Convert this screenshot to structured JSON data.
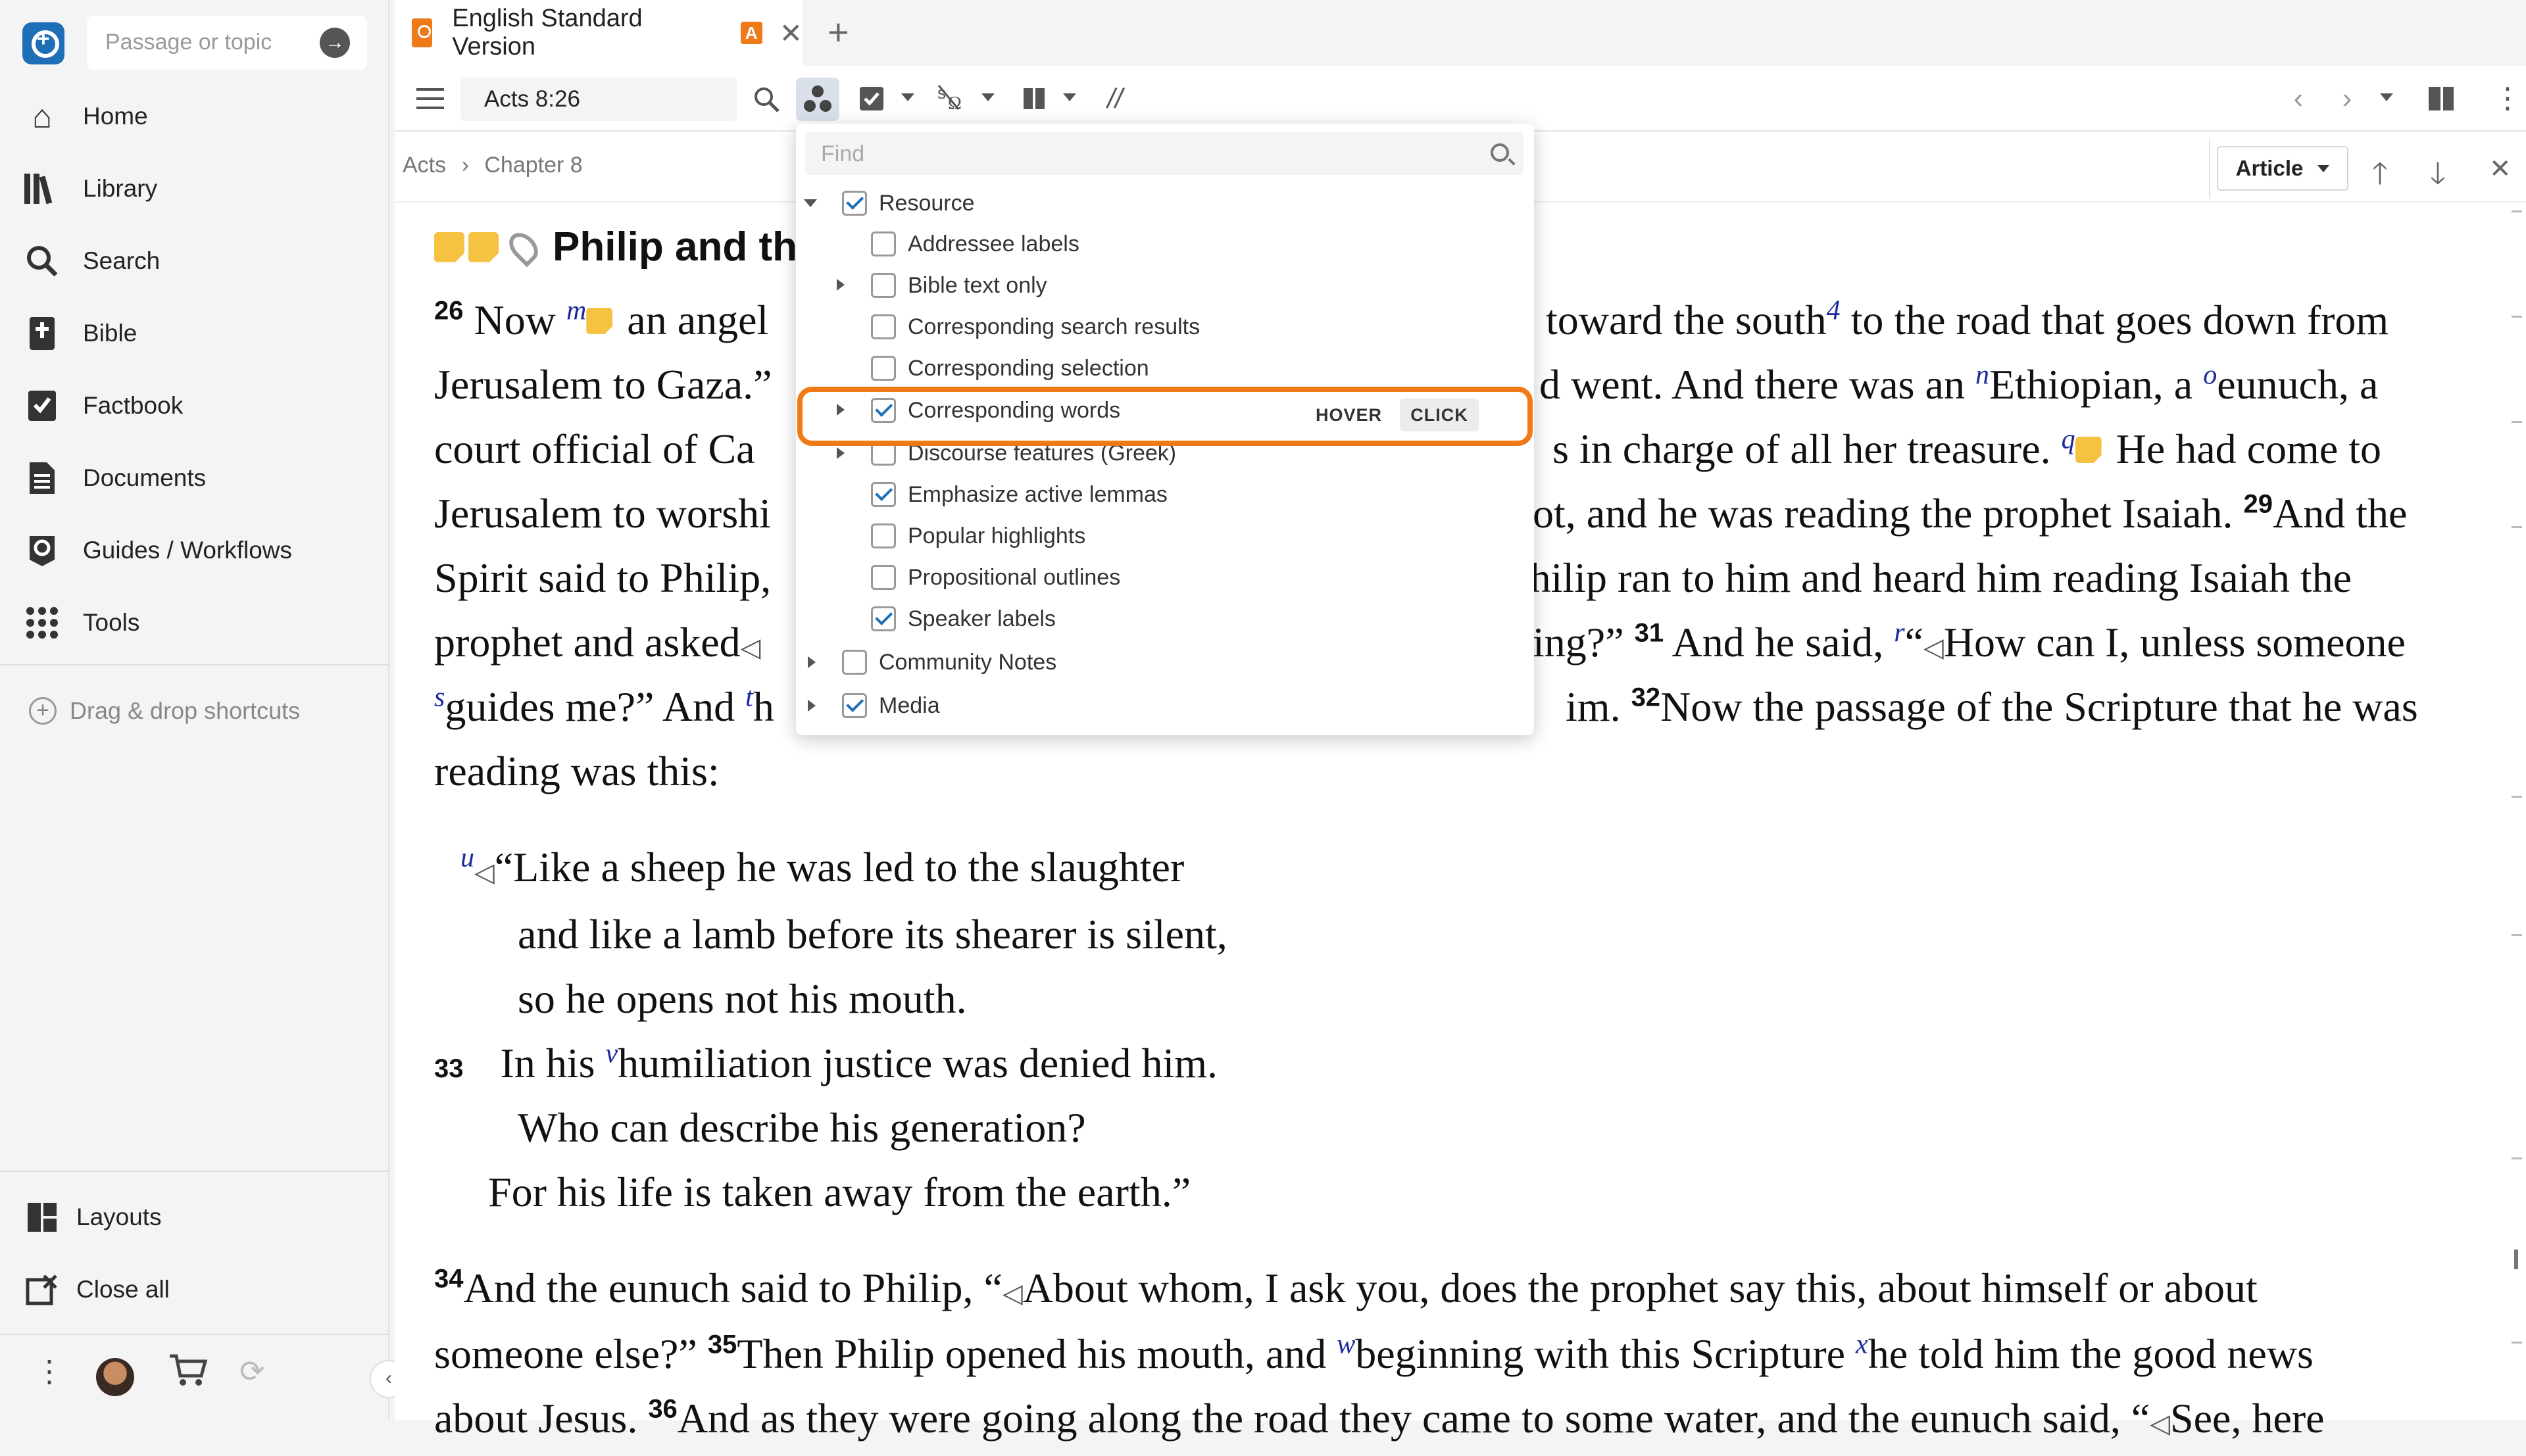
{
  "sidebar": {
    "passage_placeholder": "Passage or topic",
    "items": [
      {
        "label": "Home"
      },
      {
        "label": "Library"
      },
      {
        "label": "Search"
      },
      {
        "label": "Bible"
      },
      {
        "label": "Factbook"
      },
      {
        "label": "Documents"
      },
      {
        "label": "Guides / Workflows"
      },
      {
        "label": "Tools"
      }
    ],
    "drag_drop": "Drag & drop shortcuts",
    "layouts": "Layouts",
    "close_all": "Close all"
  },
  "tab": {
    "title": "English Standard Version",
    "badge": "A"
  },
  "toolbar": {
    "reference": "Acts 8:26",
    "parallel_marker": "//"
  },
  "breadcrumb": {
    "book": "Acts",
    "chapter": "Chapter 8"
  },
  "article_button": "Article",
  "passage": {
    "heading": "Philip and th",
    "v26_num": "26",
    "p1_line1": "Now",
    "p1_line1b": "an angel",
    "p1_line1c": "toward the south",
    "p1_line1d": "to the road that goes down from",
    "p1_line2a": "Jerusalem to Gaza.”",
    "p1_line2b": "d went. And there was an",
    "p1_line2c": "Ethiopian, a",
    "p1_line2d": "eunuch, a",
    "p1_line3a": "court official of Ca",
    "p1_line3b": "s in charge of all her treasure.",
    "p1_line3c": "He had come to",
    "p1_line4a": "Jerusalem to worshi",
    "p1_line4b": "ot, and he was reading the prophet Isaiah.",
    "v29_num": "29",
    "p1_line4c": "And the",
    "p1_line5a": "Spirit said to Philip,",
    "p1_line5b": "Philip ran to him and heard him reading Isaiah the",
    "p1_line6a": "prophet and asked",
    "p1_line6b": "ing?”",
    "v31_num": "31",
    "p1_line6c": "And he said,",
    "p1_line6d": "“",
    "p1_line6e": "How can I, unless someone",
    "p1_line7a": "guides me?” And",
    "p1_line7b": "h",
    "p1_line7c": "im.",
    "v32_num": "32",
    "p1_line7d": "Now the passage of the Scripture that he was",
    "p1_line8": "reading was this:",
    "fn_m": "m",
    "fn_4": "4",
    "fn_n": "n",
    "fn_o": "o",
    "fn_q": "q",
    "fn_r": "r",
    "fn_s": "s",
    "fn_t": "t",
    "poem": {
      "fn_u": "u",
      "l1": "“Like a sheep he was led to the slaughter",
      "l2": "and like a lamb before its shearer is silent,",
      "l3": "so he opens not his mouth.",
      "v33": "33",
      "l4a": "In his",
      "fn_v": "v",
      "l4b": "humiliation justice was denied him.",
      "l5": "Who can describe his generation?",
      "l6": "For his life is taken away from the earth.”"
    },
    "v34_num": "34",
    "p2_line1": "And the eunuch said to Philip, “",
    "p2_line1b": "About whom, I ask you, does the prophet say this, about himself or about",
    "p2_line2a": "someone else?”",
    "v35_num": "35",
    "p2_line2b": "Then Philip opened his mouth, and",
    "fn_w": "w",
    "p2_line2c": "beginning with this Scripture",
    "fn_x": "x",
    "p2_line2d": "he told him the good news",
    "p2_line3a": "about Jesus.",
    "v36_num": "36",
    "p2_line3b": "And as they were going along the road they came to some water, and the eunuch said, “",
    "p2_line3c": "See, here"
  },
  "dropdown": {
    "find_placeholder": "Find",
    "resource": {
      "label": "Resource",
      "checked": true
    },
    "items": [
      {
        "label": "Addressee labels",
        "checked": false,
        "expandable": false
      },
      {
        "label": "Bible text only",
        "checked": false,
        "expandable": true
      },
      {
        "label": "Corresponding search results",
        "checked": false,
        "expandable": false
      },
      {
        "label": "Corresponding selection",
        "checked": false,
        "expandable": false
      },
      {
        "label": "Corresponding words",
        "checked": true,
        "expandable": true
      },
      {
        "label": "Discourse features (Greek)",
        "checked": false,
        "expandable": true
      },
      {
        "label": "Emphasize active lemmas",
        "checked": true,
        "expandable": false
      },
      {
        "label": "Popular highlights",
        "checked": false,
        "expandable": false
      },
      {
        "label": "Propositional outlines",
        "checked": false,
        "expandable": false
      },
      {
        "label": "Speaker labels",
        "checked": true,
        "expandable": false
      }
    ],
    "community_notes": {
      "label": "Community Notes",
      "checked": false
    },
    "media": {
      "label": "Media",
      "checked": true
    },
    "hover_label": "HOVER",
    "click_label": "CLICK"
  },
  "colors": {
    "accent": "#1f6fb8",
    "highlight": "#f07a16",
    "resource_orange": "#ef7a1a",
    "footnote_blue": "#1a2a9c"
  }
}
